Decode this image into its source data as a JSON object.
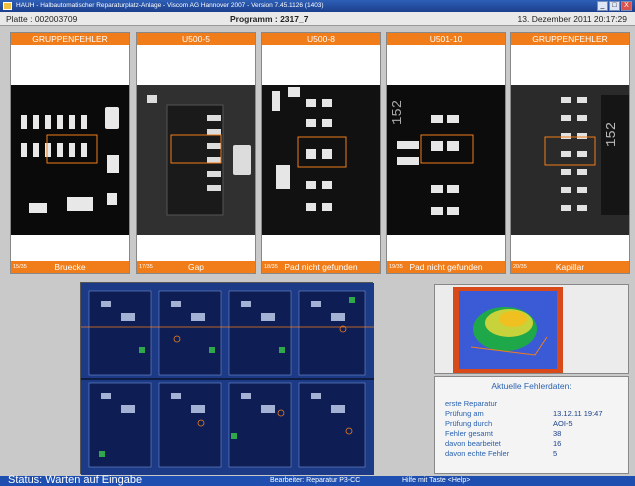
{
  "window": {
    "title": "HAUH - Halbautomatischer Reparaturplatz-Anlage - Viscom AG Hannover 2007 - Version 7.45.1126 (1403)",
    "buttons": [
      "_",
      "□",
      "X"
    ]
  },
  "info": {
    "platte": "Platte : 002003709",
    "programm": "Programm : 2317_7",
    "datetime": "13. Dezember 2011   20:17:29"
  },
  "panels": [
    {
      "header": "GRUPPENFEHLER",
      "counter": "15/35",
      "label": "Bruecke"
    },
    {
      "header": "U500-5",
      "counter": "17/35",
      "label": "Gap"
    },
    {
      "header": "U500-8",
      "counter": "18/35",
      "label": "Pad nicht gefunden"
    },
    {
      "header": "U501-10",
      "counter": "19/35",
      "label": "Pad nicht gefunden"
    },
    {
      "header": "GRUPPENFEHLER",
      "counter": "20/35",
      "label": "Kapillar"
    }
  ],
  "fehlerdaten": {
    "title": "Aktuelle Fehlerdaten:",
    "rows": [
      {
        "k": "erste Reparatur",
        "v": ""
      },
      {
        "k": "Prüfung am",
        "v": "13.12.11 19:47"
      },
      {
        "k": "Prüfung durch",
        "v": "AOI-5"
      },
      {
        "k": "Fehler gesamt",
        "v": "38"
      },
      {
        "k": "davon bearbeitet",
        "v": "16"
      },
      {
        "k": "davon echte Fehler",
        "v": "5"
      }
    ]
  },
  "status": {
    "main": "Status: Warten auf Eingabe",
    "user": "Bearbeiter: Reparatur  P3-CC",
    "help": "Hilfe mit Taste <Help>"
  },
  "colors": {
    "accent": "#f07d1a",
    "titlebar": "#1c3f8c",
    "board": "#1d3a87",
    "status": "#1e4fb0"
  }
}
